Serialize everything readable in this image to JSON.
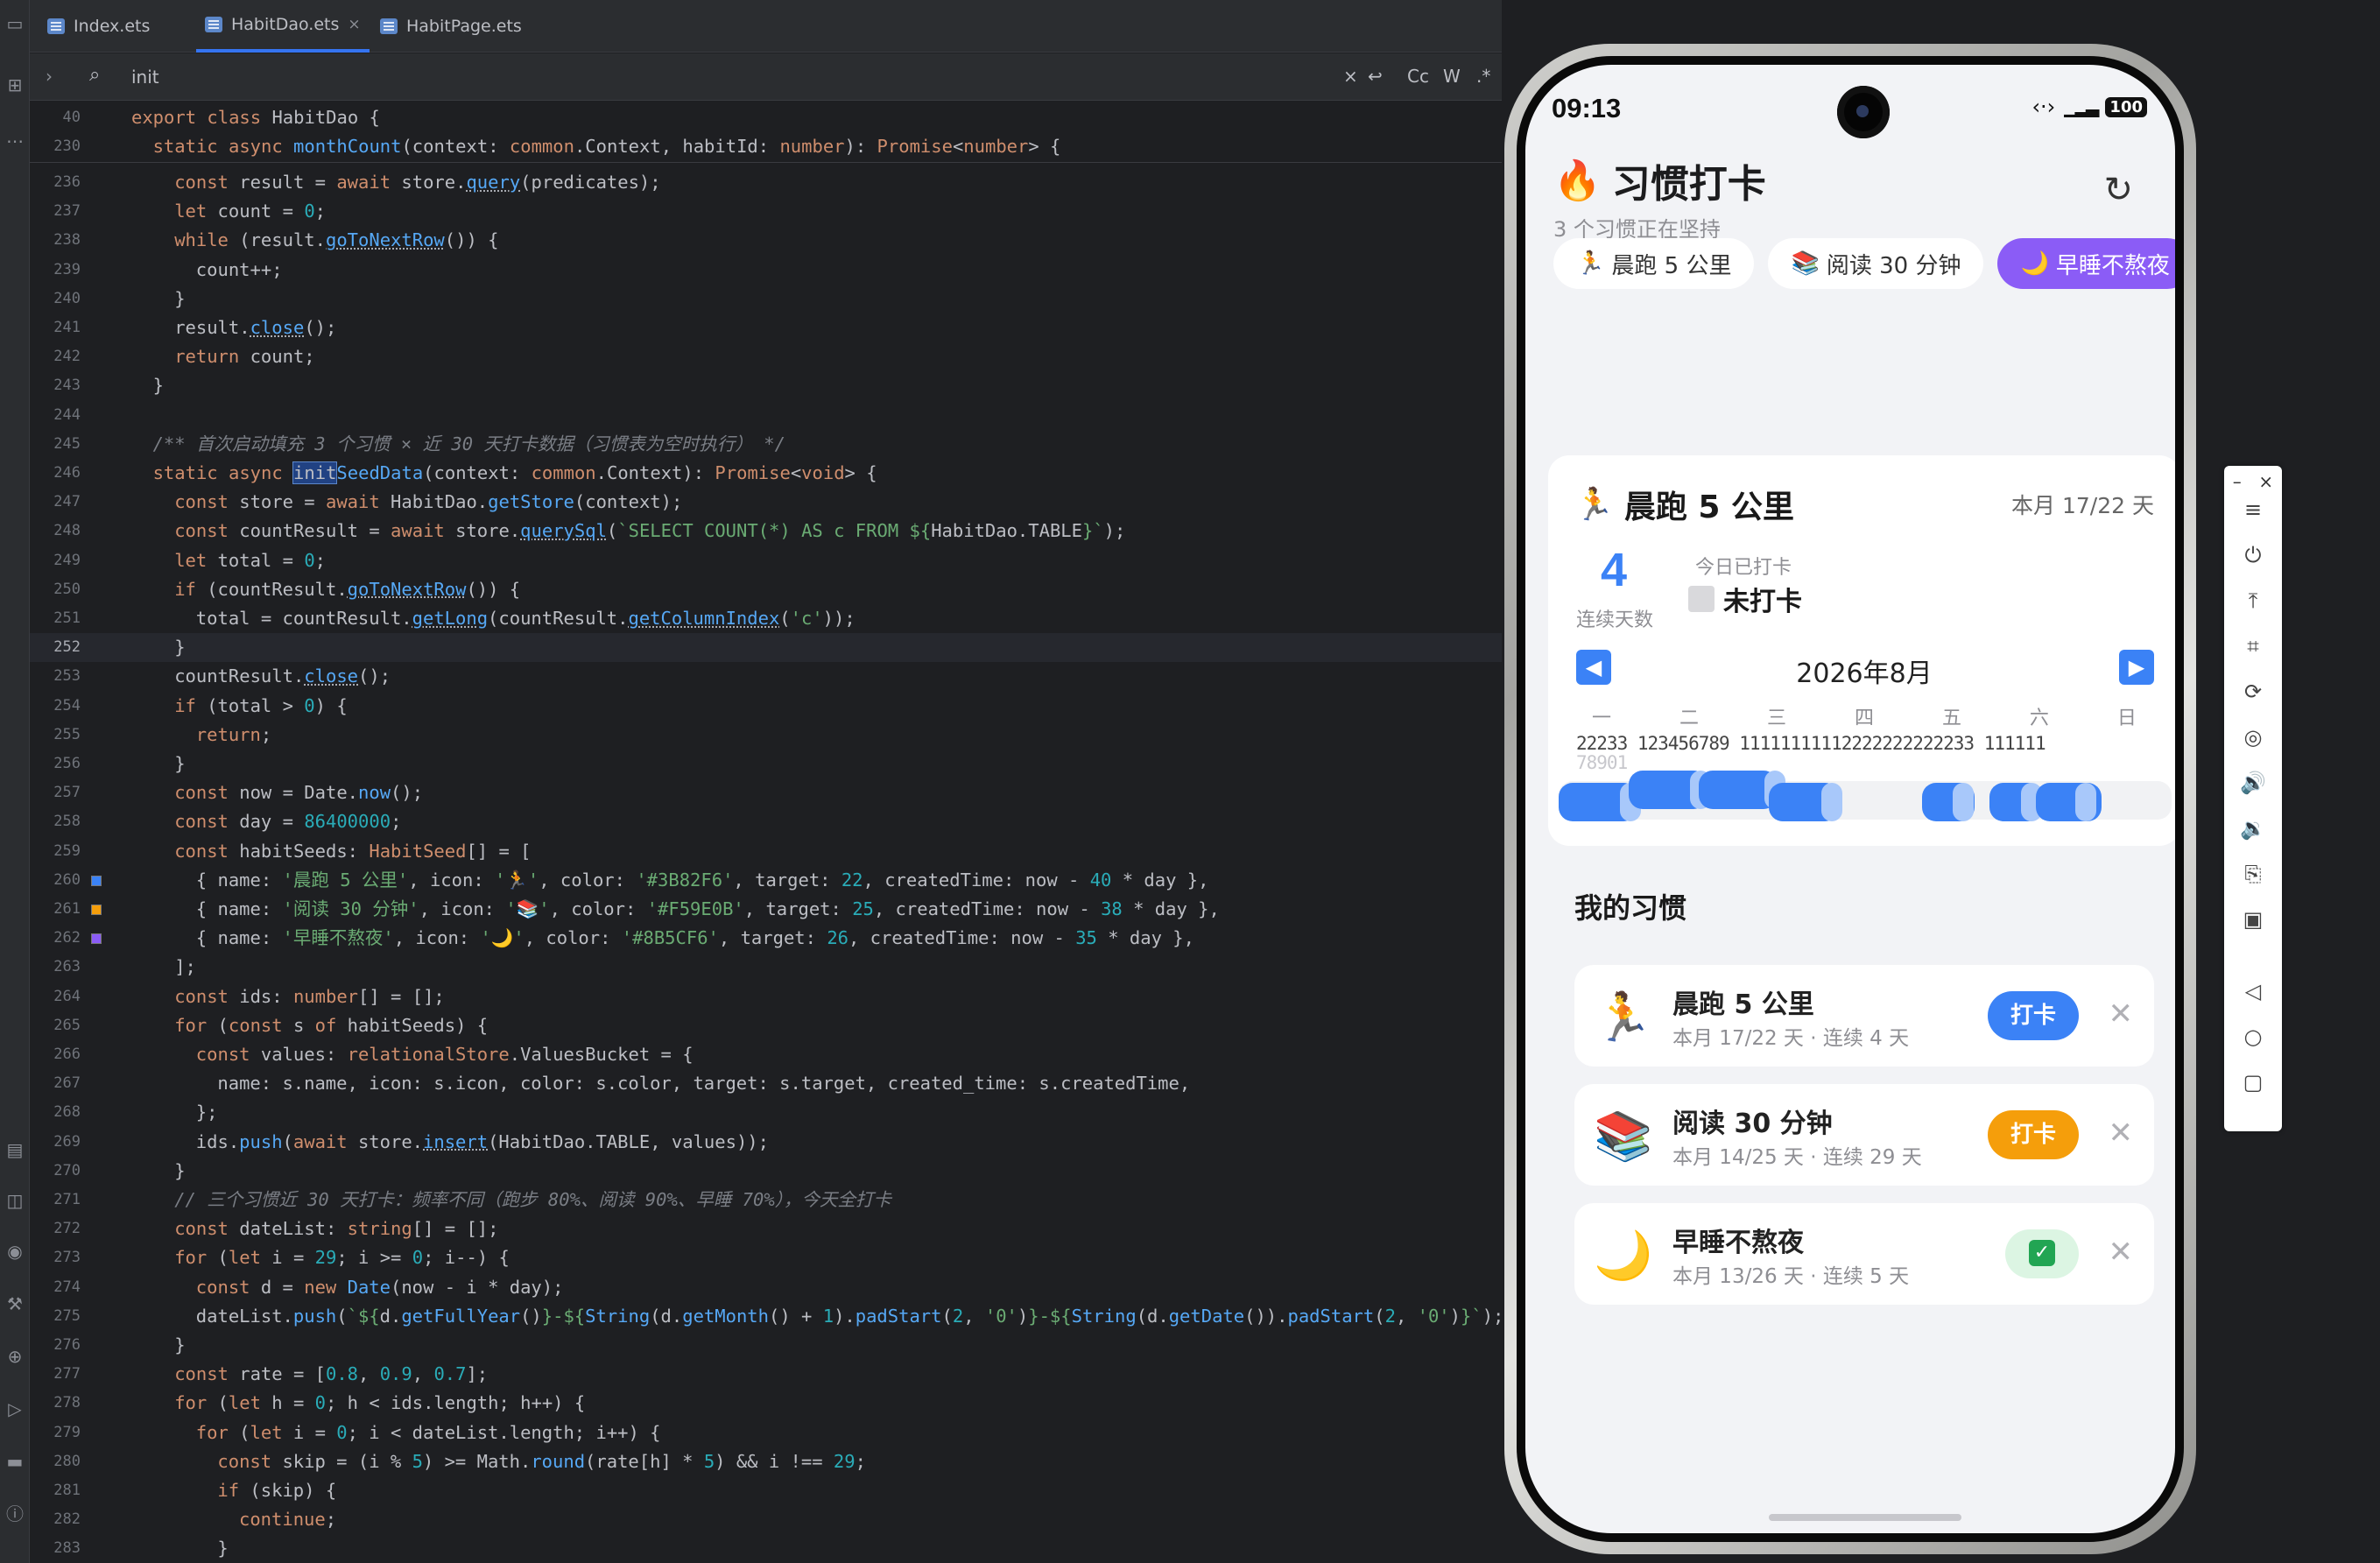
{
  "ide": {
    "tabs": [
      {
        "label": "Index.ets",
        "active": false
      },
      {
        "label": "HabitDao.ets",
        "active": true
      },
      {
        "label": "HabitPage.ets",
        "active": false
      }
    ],
    "search": {
      "value": "init",
      "options": [
        "Cc",
        "W",
        ".*"
      ]
    },
    "left_icons": [
      "folder-icon",
      "structure-icon",
      "more-icon",
      "bookmarks-icon",
      "database-icon",
      "profiler-icon",
      "build-icon",
      "services-icon",
      "run-icon",
      "terminal-icon",
      "problems-icon"
    ],
    "sticky": [
      {
        "n": "40",
        "html": "<span class='kw'>export class</span> HabitDao {",
        "ind": 0
      },
      {
        "n": "230",
        "html": "<span class='kw'>static async</span> <span class='fn'>monthCount</span>(context: <span class='ty'>common</span>.Context, habitId: <span class='ty'>number</span>): <span class='ty'>Promise</span>&lt;<span class='ty'>number</span>&gt; {",
        "ind": 1
      }
    ],
    "lines": [
      {
        "n": "236",
        "html": "<span class='kw'>const</span> result = <span class='kw'>await</span> store.<span class='fn un'>query</span>(predicates);",
        "ind": 2
      },
      {
        "n": "237",
        "html": "<span class='kw'>let</span> count = <span class='num'>0</span>;",
        "ind": 2
      },
      {
        "n": "238",
        "html": "<span class='kw'>while</span> (result.<span class='fn un'>goToNextRow</span>()) {",
        "ind": 2
      },
      {
        "n": "239",
        "html": "count++;",
        "ind": 3
      },
      {
        "n": "240",
        "html": "}",
        "ind": 2
      },
      {
        "n": "241",
        "html": "result.<span class='fn un'>close</span>();",
        "ind": 2
      },
      {
        "n": "242",
        "html": "<span class='kw'>return</span> count;",
        "ind": 2
      },
      {
        "n": "243",
        "html": "}",
        "ind": 1
      },
      {
        "n": "244",
        "html": "",
        "ind": 0
      },
      {
        "n": "245",
        "html": "<span class='cm'>/** 首次启动填充 3 个习惯 × 近 30 天打卡数据（习惯表为空时执行） */</span>",
        "ind": 1
      },
      {
        "n": "246",
        "html": "<span class='kw'>static async</span> <span class='hl'>init</span><span class='fn'>SeedData</span>(context: <span class='ty'>common</span>.Context): <span class='ty'>Promise</span>&lt;<span class='kw'>void</span>&gt; {",
        "ind": 1
      },
      {
        "n": "247",
        "html": "<span class='kw'>const</span> store = <span class='kw'>await</span> HabitDao.<span class='fn'>getStore</span>(context);",
        "ind": 2
      },
      {
        "n": "248",
        "html": "<span class='kw'>const</span> countResult = <span class='kw'>await</span> store.<span class='fn un'>querySql</span>(<span class='str'>`SELECT COUNT(*) AS c FROM ${</span>HabitDao.TABLE<span class='str'>}`</span>);",
        "ind": 2
      },
      {
        "n": "249",
        "html": "<span class='kw'>let</span> total = <span class='num'>0</span>;",
        "ind": 2
      },
      {
        "n": "250",
        "html": "<span class='kw'>if</span> (countResult.<span class='fn un'>goToNextRow</span>()) {",
        "ind": 2
      },
      {
        "n": "251",
        "html": "total = countResult.<span class='fn un'>getLong</span>(countResult.<span class='fn un'>getColumnIndex</span>(<span class='str'>'c'</span>));",
        "ind": 3
      },
      {
        "n": "252",
        "html": "}",
        "ind": 2,
        "cur": true
      },
      {
        "n": "253",
        "html": "countResult.<span class='fn un'>close</span>();",
        "ind": 2
      },
      {
        "n": "254",
        "html": "<span class='kw'>if</span> (total &gt; <span class='num'>0</span>) {",
        "ind": 2
      },
      {
        "n": "255",
        "html": "<span class='kw'>return</span>;",
        "ind": 3
      },
      {
        "n": "256",
        "html": "}",
        "ind": 2
      },
      {
        "n": "257",
        "html": "<span class='kw'>const</span> now = Date.<span class='fn'>now</span>();",
        "ind": 2
      },
      {
        "n": "258",
        "html": "<span class='kw'>const</span> day = <span class='num'>86400000</span>;",
        "ind": 2
      },
      {
        "n": "259",
        "html": "<span class='kw'>const</span> habitSeeds: <span class='ty'>HabitSeed</span>[] = [",
        "ind": 2
      },
      {
        "n": "260",
        "html": "{ name: <span class='str'>'晨跑 5 公里'</span>, icon: <span class='str'>'🏃'</span>, color: <span class='str'>'#3B82F6'</span>, target: <span class='num'>22</span>, createdTime: now - <span class='num'>40</span> * day },",
        "ind": 3,
        "sw": "#3B82F6"
      },
      {
        "n": "261",
        "html": "{ name: <span class='str'>'阅读 30 分钟'</span>, icon: <span class='str'>'📚'</span>, color: <span class='str'>'#F59E0B'</span>, target: <span class='num'>25</span>, createdTime: now - <span class='num'>38</span> * day },",
        "ind": 3,
        "sw": "#F59E0B"
      },
      {
        "n": "262",
        "html": "{ name: <span class='str'>'早睡不熬夜'</span>, icon: <span class='str'>'🌙'</span>, color: <span class='str'>'#8B5CF6'</span>, target: <span class='num'>26</span>, createdTime: now - <span class='num'>35</span> * day },",
        "ind": 3,
        "sw": "#8B5CF6"
      },
      {
        "n": "263",
        "html": "];",
        "ind": 2
      },
      {
        "n": "264",
        "html": "<span class='kw'>const</span> ids: <span class='ty'>number</span>[] = [];",
        "ind": 2
      },
      {
        "n": "265",
        "html": "<span class='kw'>for</span> (<span class='kw'>const</span> s <span class='kw'>of</span> habitSeeds) {",
        "ind": 2
      },
      {
        "n": "266",
        "html": "<span class='kw'>const</span> values: <span class='ty'>relationalStore</span>.ValuesBucket = {",
        "ind": 3
      },
      {
        "n": "267",
        "html": "name: s.name, icon: s.icon, color: s.color, target: s.target, created_time: s.createdTime,",
        "ind": 4
      },
      {
        "n": "268",
        "html": "};",
        "ind": 3
      },
      {
        "n": "269",
        "html": "ids.<span class='fn'>push</span>(<span class='kw'>await</span> store.<span class='fn un'>insert</span>(HabitDao.TABLE, values));",
        "ind": 3
      },
      {
        "n": "270",
        "html": "}",
        "ind": 2
      },
      {
        "n": "271",
        "html": "<span class='cm'>// 三个习惯近 30 天打卡：频率不同（跑步 80%、阅读 90%、早睡 70%），今天全打卡</span>",
        "ind": 2
      },
      {
        "n": "272",
        "html": "<span class='kw'>const</span> dateList: <span class='ty'>string</span>[] = [];",
        "ind": 2
      },
      {
        "n": "273",
        "html": "<span class='kw'>for</span> (<span class='kw'>let</span> i = <span class='num'>29</span>; i &gt;= <span class='num'>0</span>; i--) {",
        "ind": 2
      },
      {
        "n": "274",
        "html": "<span class='kw'>const</span> d = <span class='kw'>new</span> <span class='fn'>Date</span>(now - i * day);",
        "ind": 3
      },
      {
        "n": "275",
        "html": "dateList.<span class='fn'>push</span>(<span class='str'>`${</span>d.<span class='fn'>getFullYear</span>()<span class='str'>}-${</span><span class='fn'>String</span>(d.<span class='fn'>getMonth</span>() + <span class='num'>1</span>).<span class='fn'>padStart</span>(<span class='num'>2</span>, <span class='str'>'0'</span>)<span class='str'>}-${</span><span class='fn'>String</span>(d.<span class='fn'>getDate</span>()).<span class='fn'>padStart</span>(<span class='num'>2</span>, <span class='str'>'0'</span>)<span class='str'>}`</span>);",
        "ind": 3
      },
      {
        "n": "276",
        "html": "}",
        "ind": 2
      },
      {
        "n": "277",
        "html": "<span class='kw'>const</span> rate = [<span class='num'>0.8</span>, <span class='num'>0.9</span>, <span class='num'>0.7</span>];",
        "ind": 2
      },
      {
        "n": "278",
        "html": "<span class='kw'>for</span> (<span class='kw'>let</span> h = <span class='num'>0</span>; h &lt; ids.length; h++) {",
        "ind": 2
      },
      {
        "n": "279",
        "html": "<span class='kw'>for</span> (<span class='kw'>let</span> i = <span class='num'>0</span>; i &lt; dateList.length; i++) {",
        "ind": 3
      },
      {
        "n": "280",
        "html": "<span class='kw'>const</span> skip = (i % <span class='num'>5</span>) &gt;= Math.<span class='fn'>round</span>(rate[h] * <span class='num'>5</span>) &amp;&amp; i !== <span class='num'>29</span>;",
        "ind": 4
      },
      {
        "n": "281",
        "html": "<span class='kw'>if</span> (skip) {",
        "ind": 4
      },
      {
        "n": "282",
        "html": "<span class='kw'>continue</span>;",
        "ind": 5
      },
      {
        "n": "283",
        "html": "}",
        "ind": 4
      }
    ]
  },
  "phone": {
    "time": "09:13",
    "battery": "100",
    "title": "习惯打卡",
    "title_icon": "🔥",
    "subtitle": "3 个习惯正在坚持",
    "chips": [
      {
        "icon": "🏃",
        "label": "晨跑 5 公里",
        "active": false
      },
      {
        "icon": "📚",
        "label": "阅读 30 分钟",
        "active": false
      },
      {
        "icon": "🌙",
        "label": "早睡不熬夜",
        "active": true
      }
    ],
    "card": {
      "icon": "🏃",
      "title": "晨跑 5 公里",
      "month": "本月 17/22 天",
      "streak": "4",
      "streak_label": "连续天数",
      "today_label": "今日已打卡",
      "today_value": "未打卡",
      "calendar_title": "2026年8月",
      "weekdays": [
        "一",
        "二",
        "三",
        "四",
        "五",
        "六",
        "日"
      ],
      "daynums_top": "22233 123456789 11111111112222222222233 111111",
      "daynums_bottom": "78901"
    },
    "section_title": "我的习惯",
    "habits": [
      {
        "icon": "🏃",
        "name": "晨跑 5 公里",
        "meta": "本月 17/22 天 · 连续 4 天",
        "action": "打卡",
        "color": "#3B82F6",
        "done": false
      },
      {
        "icon": "📚",
        "name": "阅读 30 分钟",
        "meta": "本月 14/25 天 · 连续 29 天",
        "action": "打卡",
        "color": "#F59E0B",
        "done": false
      },
      {
        "icon": "🌙",
        "name": "早睡不熬夜",
        "meta": "本月 13/26 天 · 连续 5 天",
        "action": "",
        "color": "#8B5CF6",
        "done": true
      }
    ]
  }
}
